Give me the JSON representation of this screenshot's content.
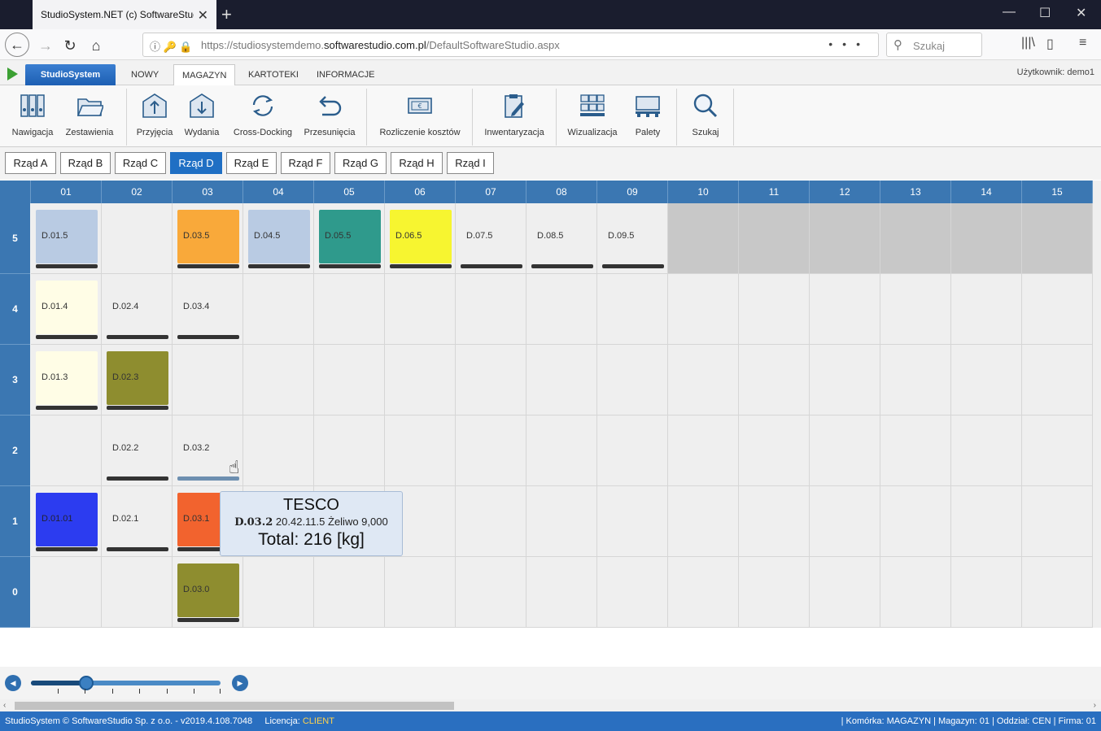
{
  "browser": {
    "tab_title": "StudioSystem.NET (c) SoftwareStudio",
    "url_prefix": "https://studiosystemdemo.",
    "url_domain": "softwarestudio.com.pl",
    "url_path": "/DefaultSoftwareStudio.aspx",
    "search_placeholder": "Szukaj"
  },
  "app": {
    "brand_tab": "StudioSystem",
    "menu": [
      "NOWY",
      "MAGAZYN",
      "KARTOTEKI",
      "INFORMACJE"
    ],
    "active_menu": "MAGAZYN",
    "user": "Użytkownik: demo1"
  },
  "ribbon": [
    {
      "label": "Nawigacja",
      "icon": "binders-icon"
    },
    {
      "label": "Zestawienia",
      "icon": "folder-icon"
    },
    {
      "label": "Przyjęcia",
      "icon": "inbound-icon"
    },
    {
      "label": "Wydania",
      "icon": "outbound-icon"
    },
    {
      "label": "Cross-Docking",
      "icon": "cycle-icon"
    },
    {
      "label": "Przesunięcia",
      "icon": "undo-arrow-icon"
    },
    {
      "label": "Rozliczenie kosztów",
      "icon": "money-icon"
    },
    {
      "label": "Inwentaryzacja",
      "icon": "clipboard-pen-icon"
    },
    {
      "label": "Wizualizacja",
      "icon": "shelves-icon"
    },
    {
      "label": "Palety",
      "icon": "pallet-icon"
    },
    {
      "label": "Szukaj",
      "icon": "magnifier-icon"
    }
  ],
  "rows": [
    "Rząd A",
    "Rząd B",
    "Rząd C",
    "Rząd D",
    "Rząd E",
    "Rząd F",
    "Rząd G",
    "Rząd H",
    "Rząd I"
  ],
  "active_row": "Rząd D",
  "grid": {
    "columns": [
      "01",
      "02",
      "03",
      "04",
      "05",
      "06",
      "07",
      "08",
      "09",
      "10",
      "11",
      "12",
      "13",
      "14",
      "15"
    ],
    "levels": [
      "5",
      "4",
      "3",
      "2",
      "1",
      "0"
    ],
    "slots": [
      {
        "code": "D.01.5",
        "level": "5",
        "col": "01",
        "color": "#b9cbe3"
      },
      {
        "code": "D.03.5",
        "level": "5",
        "col": "03",
        "color": "#f9a93a"
      },
      {
        "code": "D.04.5",
        "level": "5",
        "col": "04",
        "color": "#b9cbe3"
      },
      {
        "code": "D.05.5",
        "level": "5",
        "col": "05",
        "color": "#2f9a8c"
      },
      {
        "code": "D.06.5",
        "level": "5",
        "col": "06",
        "color": "#f7f530"
      },
      {
        "code": "D.07.5",
        "level": "5",
        "col": "07",
        "color": ""
      },
      {
        "code": "D.08.5",
        "level": "5",
        "col": "08",
        "color": ""
      },
      {
        "code": "D.09.5",
        "level": "5",
        "col": "09",
        "color": ""
      },
      {
        "code": "D.01.4",
        "level": "4",
        "col": "01",
        "color": "#fffde6"
      },
      {
        "code": "D.02.4",
        "level": "4",
        "col": "02",
        "color": ""
      },
      {
        "code": "D.03.4",
        "level": "4",
        "col": "03",
        "color": ""
      },
      {
        "code": "D.01.3",
        "level": "3",
        "col": "01",
        "color": "#fffde6"
      },
      {
        "code": "D.02.3",
        "level": "3",
        "col": "02",
        "color": "#8e8d2f"
      },
      {
        "code": "D.02.2",
        "level": "2",
        "col": "02",
        "color": ""
      },
      {
        "code": "D.03.2",
        "level": "2",
        "col": "03",
        "color": ""
      },
      {
        "code": "D.01.01",
        "level": "1",
        "col": "01",
        "color": "#2c3cf0"
      },
      {
        "code": "D.02.1",
        "level": "1",
        "col": "02",
        "color": ""
      },
      {
        "code": "D.03.1",
        "level": "1",
        "col": "03",
        "color": "#f2632e"
      },
      {
        "code": "D.03.0",
        "level": "0",
        "col": "03",
        "color": "#8e8d2f"
      }
    ],
    "disabled_columns_level5": [
      "10",
      "11",
      "12",
      "13",
      "14",
      "15"
    ]
  },
  "tooltip": {
    "title": "TESCO",
    "code": "D.03.2",
    "detail": "20.42.11.5 Żeliwo 9,000",
    "total": "Total: 216 [kg]"
  },
  "slider": {
    "value_fraction": 0.29
  },
  "status": {
    "left": "StudioSystem © SoftwareStudio Sp. z o.o. - v2019.4.108.7048",
    "license_label": "Licencja:",
    "license_value": "CLIENT",
    "right": "| Komórka: MAGAZYN | Magazyn: 01 | Oddział: CEN | Firma: 01"
  }
}
